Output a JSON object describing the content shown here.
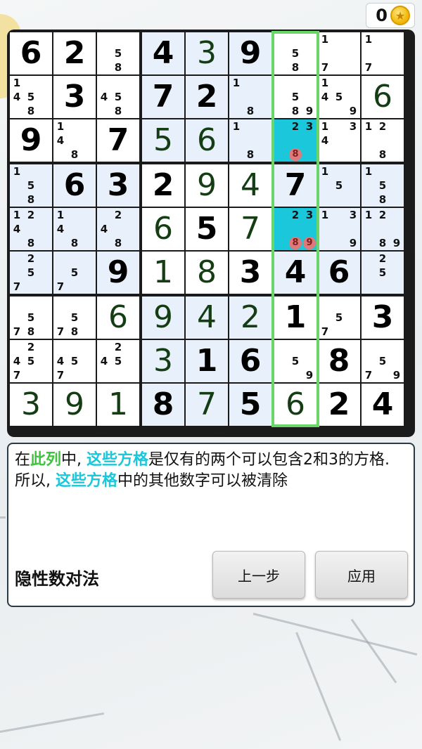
{
  "coins": {
    "count": "0",
    "icon": "coin-icon"
  },
  "board": {
    "rows": [
      [
        {
          "v": "6",
          "t": "given"
        },
        {
          "v": "2",
          "t": "given"
        },
        {
          "c": [
            5,
            8
          ]
        },
        {
          "v": "4",
          "t": "given"
        },
        {
          "v": "3",
          "t": "user"
        },
        {
          "v": "9",
          "t": "given"
        },
        {
          "c": [
            5,
            8
          ]
        },
        {
          "c": [
            1,
            7
          ]
        },
        {
          "c": [
            1,
            7
          ]
        }
      ],
      [
        {
          "c": [
            1,
            4,
            5,
            8
          ]
        },
        {
          "v": "3",
          "t": "given"
        },
        {
          "c": [
            4,
            5,
            8
          ]
        },
        {
          "v": "7",
          "t": "given"
        },
        {
          "v": "2",
          "t": "given"
        },
        {
          "c": [
            1,
            8
          ]
        },
        {
          "c": [
            5,
            8,
            9
          ]
        },
        {
          "c": [
            1,
            4,
            5,
            9
          ]
        },
        {
          "v": "6",
          "t": "user"
        }
      ],
      [
        {
          "v": "9",
          "t": "given"
        },
        {
          "c": [
            1,
            4,
            8
          ]
        },
        {
          "v": "7",
          "t": "given"
        },
        {
          "v": "5",
          "t": "user"
        },
        {
          "v": "6",
          "t": "user"
        },
        {
          "c": [
            1,
            8
          ]
        },
        {
          "c": [
            2,
            3
          ],
          "e": [
            8
          ],
          "hl": true
        },
        {
          "c": [
            1,
            3,
            4
          ]
        },
        {
          "c": [
            1,
            2,
            8
          ]
        }
      ],
      [
        {
          "c": [
            1,
            5,
            8
          ]
        },
        {
          "v": "6",
          "t": "given"
        },
        {
          "v": "3",
          "t": "given"
        },
        {
          "v": "2",
          "t": "given"
        },
        {
          "v": "9",
          "t": "user"
        },
        {
          "v": "4",
          "t": "user"
        },
        {
          "v": "7",
          "t": "given"
        },
        {
          "c": [
            1,
            5
          ]
        },
        {
          "c": [
            1,
            5,
            8
          ]
        }
      ],
      [
        {
          "c": [
            1,
            2,
            4,
            8
          ]
        },
        {
          "c": [
            1,
            4,
            8
          ]
        },
        {
          "c": [
            2,
            4,
            8
          ]
        },
        {
          "v": "6",
          "t": "user"
        },
        {
          "v": "5",
          "t": "given"
        },
        {
          "v": "7",
          "t": "user"
        },
        {
          "c": [
            2,
            3
          ],
          "e": [
            8,
            9
          ],
          "hl": true
        },
        {
          "c": [
            1,
            3,
            9
          ]
        },
        {
          "c": [
            1,
            2,
            8,
            9
          ]
        }
      ],
      [
        {
          "c": [
            2,
            5,
            7
          ]
        },
        {
          "c": [
            5,
            7
          ]
        },
        {
          "v": "9",
          "t": "given"
        },
        {
          "v": "1",
          "t": "user"
        },
        {
          "v": "8",
          "t": "user"
        },
        {
          "v": "3",
          "t": "given"
        },
        {
          "v": "4",
          "t": "given"
        },
        {
          "v": "6",
          "t": "given"
        },
        {
          "c": [
            2,
            5
          ]
        }
      ],
      [
        {
          "c": [
            5,
            7,
            8
          ]
        },
        {
          "c": [
            5,
            7,
            8
          ]
        },
        {
          "v": "6",
          "t": "user"
        },
        {
          "v": "9",
          "t": "user"
        },
        {
          "v": "4",
          "t": "user"
        },
        {
          "v": "2",
          "t": "user"
        },
        {
          "v": "1",
          "t": "given"
        },
        {
          "c": [
            5,
            7
          ]
        },
        {
          "v": "3",
          "t": "given"
        }
      ],
      [
        {
          "c": [
            2,
            4,
            5,
            7
          ]
        },
        {
          "c": [
            4,
            5,
            7
          ]
        },
        {
          "c": [
            2,
            4,
            5
          ]
        },
        {
          "v": "3",
          "t": "user"
        },
        {
          "v": "1",
          "t": "given"
        },
        {
          "v": "6",
          "t": "given"
        },
        {
          "c": [
            5,
            9
          ]
        },
        {
          "v": "8",
          "t": "given"
        },
        {
          "c": [
            5,
            7,
            9
          ]
        }
      ],
      [
        {
          "v": "3",
          "t": "user"
        },
        {
          "v": "9",
          "t": "user"
        },
        {
          "v": "1",
          "t": "user"
        },
        {
          "v": "8",
          "t": "given"
        },
        {
          "v": "7",
          "t": "user"
        },
        {
          "v": "5",
          "t": "given"
        },
        {
          "v": "6",
          "t": "user"
        },
        {
          "v": "2",
          "t": "given"
        },
        {
          "v": "4",
          "t": "given"
        }
      ]
    ],
    "highlight_column": 6,
    "colors": {
      "highlight_cell": "#1bc7da",
      "column_frame": "#6ad66a",
      "eliminated": "#e07a7a"
    }
  },
  "hint": {
    "parts": [
      {
        "text": "在",
        "style": "plain"
      },
      {
        "text": "此列",
        "style": "green"
      },
      {
        "text": "中, ",
        "style": "plain"
      },
      {
        "text": "这些方格",
        "style": "cyan"
      },
      {
        "text": "是仅有的两个可以包含2和3的方格. 所以, ",
        "style": "plain"
      },
      {
        "text": "这些方格",
        "style": "cyan"
      },
      {
        "text": "中的其他数字可以被清除",
        "style": "plain"
      }
    ],
    "technique": "隐性数对法",
    "prev_label": "上一步",
    "apply_label": "应用"
  }
}
